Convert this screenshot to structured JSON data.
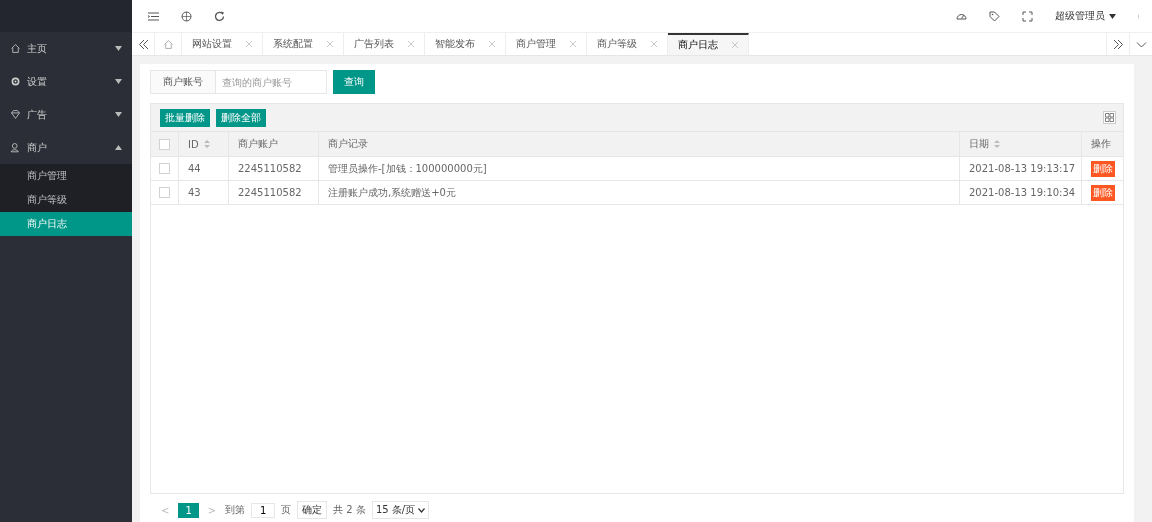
{
  "sidebar": {
    "items": [
      {
        "label": "主页",
        "expanded": false
      },
      {
        "label": "设置",
        "expanded": false
      },
      {
        "label": "广告",
        "expanded": false
      },
      {
        "label": "商户",
        "expanded": true,
        "children": [
          {
            "label": "商户管理",
            "selected": false
          },
          {
            "label": "商户等级",
            "selected": false
          },
          {
            "label": "商户日志",
            "selected": true
          }
        ]
      }
    ]
  },
  "header": {
    "user": "超级管理员"
  },
  "tabs": [
    {
      "label": "网站设置",
      "selected": false
    },
    {
      "label": "系统配置",
      "selected": false
    },
    {
      "label": "广告列表",
      "selected": false
    },
    {
      "label": "智能发布",
      "selected": false
    },
    {
      "label": "商户管理",
      "selected": false
    },
    {
      "label": "商户等级",
      "selected": false
    },
    {
      "label": "商户日志",
      "selected": true
    }
  ],
  "search": {
    "label": "商户账号",
    "placeholder": "查询的商户账号",
    "button": "查询"
  },
  "toolbar": {
    "buttons": [
      "批量删除",
      "删除全部"
    ]
  },
  "table": {
    "columns": [
      {
        "label": "ID",
        "sortable": true
      },
      {
        "label": "商户账户",
        "sortable": false
      },
      {
        "label": "商户记录",
        "sortable": false
      },
      {
        "label": "日期",
        "sortable": true
      },
      {
        "label": "操作",
        "sortable": false
      }
    ],
    "header_checked": false,
    "rows": [
      {
        "checked": false,
        "cells": [
          "44",
          "2245110582",
          "管理员操作-[加钱：100000000元]",
          "2021-08-13 19:13:17"
        ],
        "action": "删除"
      },
      {
        "checked": false,
        "cells": [
          "43",
          "2245110582",
          "注册账户成功,系统赠送+0元",
          "2021-08-13 19:10:34"
        ],
        "action": "删除"
      }
    ]
  },
  "pagination": {
    "prev": "<",
    "pages": [
      {
        "label": "1",
        "selected": true
      }
    ],
    "next": ">",
    "goto": "到第",
    "page_value": "1",
    "page_unit": "页",
    "confirm": "确定",
    "total": "共 2 条",
    "page_size": "15 条/页"
  }
}
